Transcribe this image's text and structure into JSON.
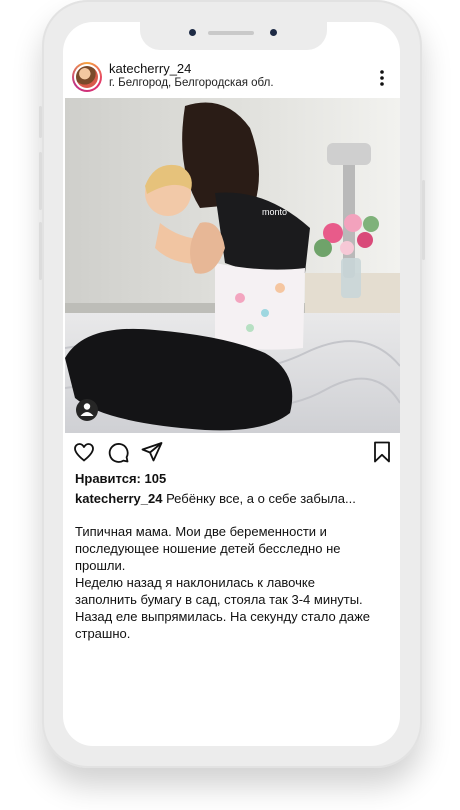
{
  "post": {
    "username": "katecherry_24",
    "location": "г. Белгород, Белгородская обл.",
    "photo_text": "monto",
    "likes": "Нравится: 105",
    "caption_user": "katecherry_24",
    "caption_text": " Ребёнку все, а о себе забыла...",
    "body_lines": [
      "Типичная мама. Мои две беременности и",
      "последующее ношение детей бесследно не",
      "прошли.",
      "Неделю назад я наклонилась к лавочке",
      "заполнить бумагу в сад, стояла так 3-4 минуты.",
      "Назад еле выпрямилась. На секунду стало даже",
      "страшно."
    ]
  },
  "icons": {
    "more": "more-vertical-icon",
    "user_tag": "user-tag-icon",
    "like": "heart-icon",
    "comment": "comment-icon",
    "share": "send-icon",
    "save": "bookmark-icon"
  },
  "colors": {
    "frame": "#ececec",
    "text": "#111111",
    "screen": "#ffffff"
  }
}
